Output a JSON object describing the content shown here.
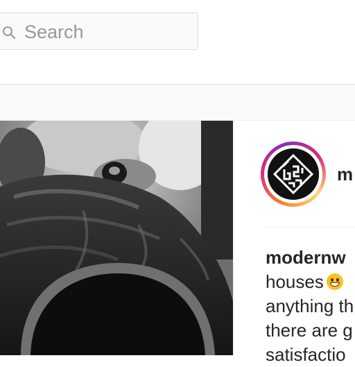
{
  "search": {
    "placeholder": "Search"
  },
  "post": {
    "header_username": "m",
    "caption": {
      "username": "modernw",
      "lines": [
        "houses",
        "anything th",
        "there are g",
        "satisfactio"
      ]
    }
  },
  "icons": {
    "search": "search-icon",
    "emoji": "grinning-emoji-icon"
  },
  "colors": {
    "border": "#dbdbdb",
    "placeholder": "#999999",
    "text": "#262626",
    "ring_start": "#f58529",
    "ring_mid": "#dd2a7b",
    "ring_end": "#8134af"
  }
}
